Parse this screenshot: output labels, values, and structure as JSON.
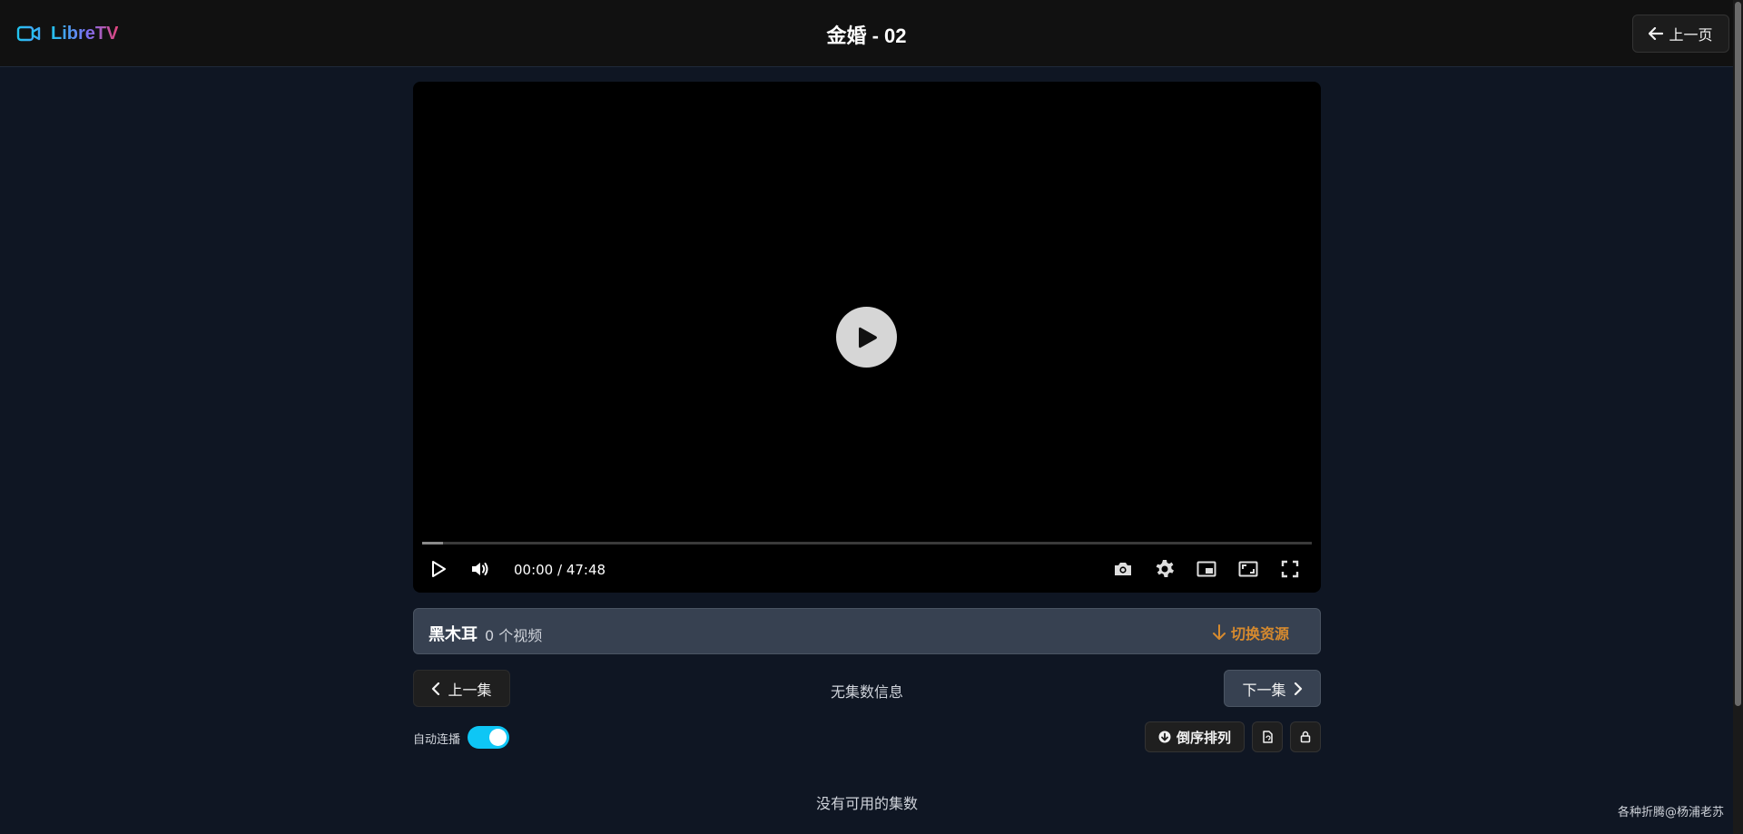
{
  "header": {
    "logo_text": "LibreTV",
    "title": "金婚 - 02",
    "back_label": "上一页"
  },
  "player": {
    "current_time": "00:00",
    "duration": "47:48",
    "time_separator": " / ",
    "buffered_fraction": 0.023,
    "played_fraction": 0.0,
    "controls": [
      "play-icon",
      "volume-icon",
      "screenshot-icon",
      "settings-icon",
      "picture-in-picture-icon",
      "web-fullscreen-icon",
      "fullscreen-icon"
    ]
  },
  "source": {
    "name": "黑木耳",
    "count_text": "0 个视频",
    "switch_label": "切换资源"
  },
  "episodes": {
    "prev_label": "上一集",
    "info_text": "无集数信息",
    "next_label": "下一集",
    "autoplay_label": "自动连播",
    "autoplay_on": true,
    "reverse_label": "倒序排列",
    "empty_text": "没有可用的集数"
  },
  "footer": {
    "credit": "各种折腾@杨浦老苏"
  },
  "colors": {
    "page_bg": "#0f1623",
    "accent_cyan": "#0ec6f5",
    "switch_orange": "#d68a2e",
    "panel_bg": "#374151"
  }
}
